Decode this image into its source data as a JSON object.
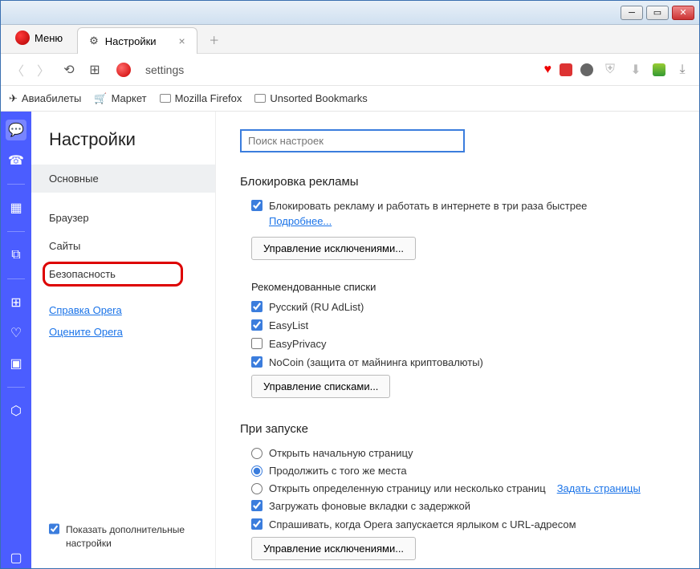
{
  "menu_label": "Меню",
  "tab": {
    "label": "Настройки"
  },
  "address": "settings",
  "bookmarks": [
    "Авиабилеты",
    "Маркет",
    "Mozilla Firefox",
    "Unsorted Bookmarks"
  ],
  "settings": {
    "title": "Настройки",
    "nav": {
      "basic": "Основные",
      "browser": "Браузер",
      "sites": "Сайты",
      "security": "Безопасность",
      "help": "Справка Opera",
      "rate": "Оцените Opera",
      "show_advanced": "Показать дополнительные настройки"
    }
  },
  "search_placeholder": "Поиск настроек",
  "adblock": {
    "title": "Блокировка рекламы",
    "enable": "Блокировать рекламу и работать в интернете в три раза быстрее",
    "more": "Подробнее...",
    "exceptions_btn": "Управление исключениями...",
    "lists_title": "Рекомендованные списки",
    "list_ru": "Русский (RU AdList)",
    "list_easylist": "EasyList",
    "list_easyprivacy": "EasyPrivacy",
    "list_nocoin": "NoCoin (защита от майнинга криптовалюты)",
    "manage_lists_btn": "Управление списками..."
  },
  "startup": {
    "title": "При запуске",
    "open_start": "Открыть начальную страницу",
    "continue": "Продолжить с того же места",
    "open_specific": "Открыть определенную страницу или несколько страниц",
    "set_pages": "Задать страницы",
    "bg_tabs": "Загружать фоновые вкладки с задержкой",
    "ask_url": "Спрашивать, когда Opera запускается ярлыком с URL-адресом",
    "exceptions_btn": "Управление исключениями..."
  }
}
